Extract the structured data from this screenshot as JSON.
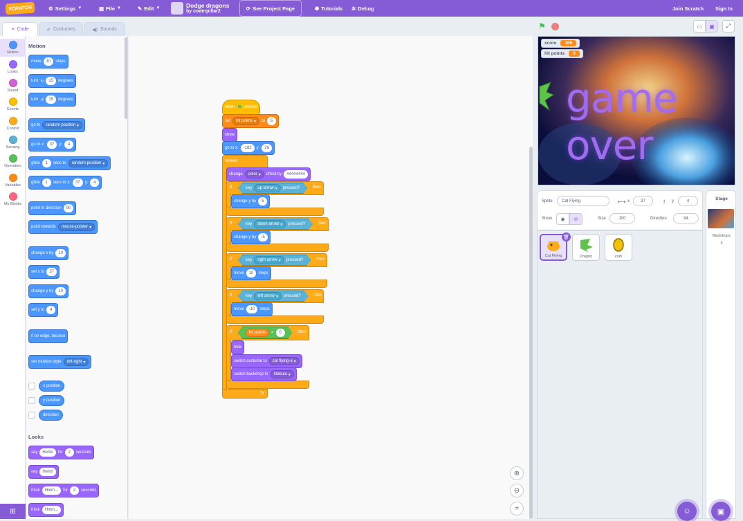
{
  "menubar": {
    "logo": "SCRATCH",
    "settings": "Settings",
    "file": "File",
    "edit": "Edit",
    "project_title": "Dodge dragons",
    "project_author": "by coderpillar2",
    "see_project": "See Project Page",
    "tutorials": "Tutorials",
    "debug": "Debug",
    "join": "Join Scratch",
    "signin": "Sign In"
  },
  "tabs": {
    "code": "Code",
    "costumes": "Costumes",
    "sounds": "Sounds"
  },
  "categories": [
    {
      "label": "Motion",
      "color": "#4c97ff"
    },
    {
      "label": "Looks",
      "color": "#9966ff"
    },
    {
      "label": "Sound",
      "color": "#cf63cf"
    },
    {
      "label": "Events",
      "color": "#ffbf00"
    },
    {
      "label": "Control",
      "color": "#ffab19"
    },
    {
      "label": "Sensing",
      "color": "#5cb1d6"
    },
    {
      "label": "Operators",
      "color": "#59c059"
    },
    {
      "label": "Variables",
      "color": "#ff8c1a"
    },
    {
      "label": "My Blocks",
      "color": "#ff6680"
    }
  ],
  "palette": {
    "motion_title": "Motion",
    "move": "move",
    "move_val": "10",
    "steps": "steps",
    "turn": "turn",
    "turn_val": "15",
    "degrees": "degrees",
    "goto": "go to",
    "goto_dd": "random position",
    "gotoxy": "go to x:",
    "gx": "37",
    "y_lbl": "y:",
    "gy": "4",
    "glide": "glide",
    "glide_val": "1",
    "secs_to": "secs to",
    "glide_dd": "random position",
    "secs_to_x": "secs to x:",
    "point_dir": "point in direction",
    "dir_val": "90",
    "point_towards": "point towards",
    "towards_dd": "mouse-pointer",
    "change_x": "change x by",
    "cx": "10",
    "set_x": "set x to",
    "sx": "37",
    "change_y": "change y by",
    "cy": "10",
    "set_y": "set y to",
    "sy": "4",
    "bounce": "if on edge, bounce",
    "rotation": "set rotation style",
    "rot_dd": "left-right",
    "xpos": "x position",
    "ypos": "y position",
    "direction": "direction",
    "looks_title": "Looks",
    "say": "say",
    "hello": "Hello!",
    "for": "for",
    "two": "2",
    "seconds": "seconds",
    "think": "think",
    "hmm": "Hmm..."
  },
  "script": {
    "when": "when",
    "clicked": "clicked",
    "set": "set",
    "var_dd": "hit points",
    "to": "to",
    "set_val": "5",
    "show": "show",
    "goto": "go to x:",
    "gx": "-182",
    "y_lbl": "y:",
    "gy": "26",
    "forever": "forever",
    "change": "change",
    "effect_dd": "color",
    "effect_by": "effect by",
    "effect_val": "44444444",
    "if": "if",
    "then": "then",
    "key": "key",
    "pressed": "pressed?",
    "up": "up arrow",
    "down": "down arrow",
    "right": "right arrow",
    "left": "left arrow",
    "change_y": "change y by",
    "up_val": "5",
    "down_val": "-5",
    "move": "move",
    "steps": "steps",
    "right_val": "10",
    "left_val": "-10",
    "hp": "hit points",
    "eq": "=",
    "zero": "0",
    "hide": "hide",
    "switch_costume": "switch costume to",
    "costume_dd": "cat flying-a",
    "switch_backdrop": "switch backdrop to",
    "backdrop_dd": "Nebula"
  },
  "stage": {
    "score_label": "score",
    "score_val": "105",
    "hp_label": "hit points",
    "hp_val": "0",
    "game_over": "game over"
  },
  "sprite_info": {
    "sprite_label": "Sprite",
    "sprite_name": "Cat Flying",
    "x_label": "x",
    "x_val": "37",
    "y_label": "y",
    "y_val": "4",
    "show_label": "Show",
    "size_label": "Size",
    "size_val": "100",
    "direction_label": "Direction",
    "direction_val": "94"
  },
  "sprites": [
    {
      "name": "Cat Flying"
    },
    {
      "name": "Dragon"
    },
    {
      "name": "coin"
    }
  ],
  "stage_pane": {
    "title": "Stage",
    "backdrops_label": "Backdrops",
    "backdrops_count": "3"
  }
}
